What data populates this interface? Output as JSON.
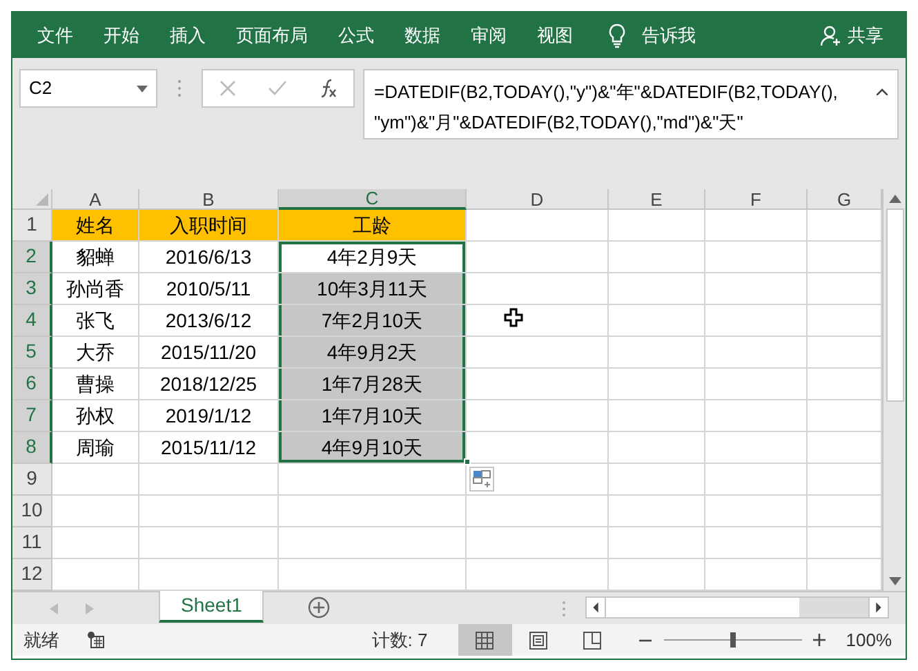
{
  "ribbon": {
    "tabs": [
      "文件",
      "开始",
      "插入",
      "页面布局",
      "公式",
      "数据",
      "审阅",
      "视图"
    ],
    "tell_me": "告诉我",
    "share": "共享"
  },
  "formula_bar": {
    "name_box": "C2",
    "formula": "=DATEDIF(B2,TODAY(),\"y\")&\"年\"&DATEDIF(B2,TODAY(),\n\"ym\")&\"月\"&DATEDIF(B2,TODAY(),\"md\")&\"天\""
  },
  "columns": [
    {
      "label": "A",
      "selected": false
    },
    {
      "label": "B",
      "selected": false
    },
    {
      "label": "C",
      "selected": true
    },
    {
      "label": "D",
      "selected": false
    },
    {
      "label": "E",
      "selected": false
    },
    {
      "label": "F",
      "selected": false
    },
    {
      "label": "G",
      "selected": false
    }
  ],
  "rows": [
    {
      "number": "1",
      "selected": false,
      "kind": "header",
      "cells": [
        "姓名",
        "入职时间"
      ],
      "tenure": {
        "text": "工龄",
        "selected": false,
        "active": false
      }
    },
    {
      "number": "2",
      "selected": true,
      "kind": "data",
      "cells": [
        "貂蝉",
        "2016/6/13"
      ],
      "tenure": {
        "text": "4年2月9天",
        "selected": true,
        "active": true
      }
    },
    {
      "number": "3",
      "selected": true,
      "kind": "data",
      "cells": [
        "孙尚香",
        "2010/5/11"
      ],
      "tenure": {
        "text": "10年3月11天",
        "selected": true,
        "active": false
      }
    },
    {
      "number": "4",
      "selected": true,
      "kind": "data",
      "cells": [
        "张飞",
        "2013/6/12"
      ],
      "tenure": {
        "text": "7年2月10天",
        "selected": true,
        "active": false
      }
    },
    {
      "number": "5",
      "selected": true,
      "kind": "data",
      "cells": [
        "大乔",
        "2015/11/20"
      ],
      "tenure": {
        "text": "4年9月2天",
        "selected": true,
        "active": false
      }
    },
    {
      "number": "6",
      "selected": true,
      "kind": "data",
      "cells": [
        "曹操",
        "2018/12/25"
      ],
      "tenure": {
        "text": "1年7月28天",
        "selected": true,
        "active": false
      }
    },
    {
      "number": "7",
      "selected": true,
      "kind": "data",
      "cells": [
        "孙权",
        "2019/1/12"
      ],
      "tenure": {
        "text": "1年7月10天",
        "selected": true,
        "active": false
      }
    },
    {
      "number": "8",
      "selected": true,
      "kind": "data",
      "cells": [
        "周瑜",
        "2015/11/12"
      ],
      "tenure": {
        "text": "4年9月10天",
        "selected": true,
        "active": false
      }
    },
    {
      "number": "9",
      "selected": false,
      "kind": "empty"
    },
    {
      "number": "10",
      "selected": false,
      "kind": "empty"
    },
    {
      "number": "11",
      "selected": false,
      "kind": "empty"
    },
    {
      "number": "12",
      "selected": false,
      "kind": "empty"
    }
  ],
  "sheet_tabs": [
    {
      "label": "Sheet1",
      "selected": true
    }
  ],
  "status_bar": {
    "mode": "就绪",
    "count": "计数: 7",
    "views": [
      {
        "kind": "normal",
        "selected": true
      },
      {
        "kind": "page-layout",
        "selected": false
      },
      {
        "kind": "page-break",
        "selected": false
      }
    ],
    "zoom": {
      "level": 0.5,
      "reading": "100%"
    }
  }
}
